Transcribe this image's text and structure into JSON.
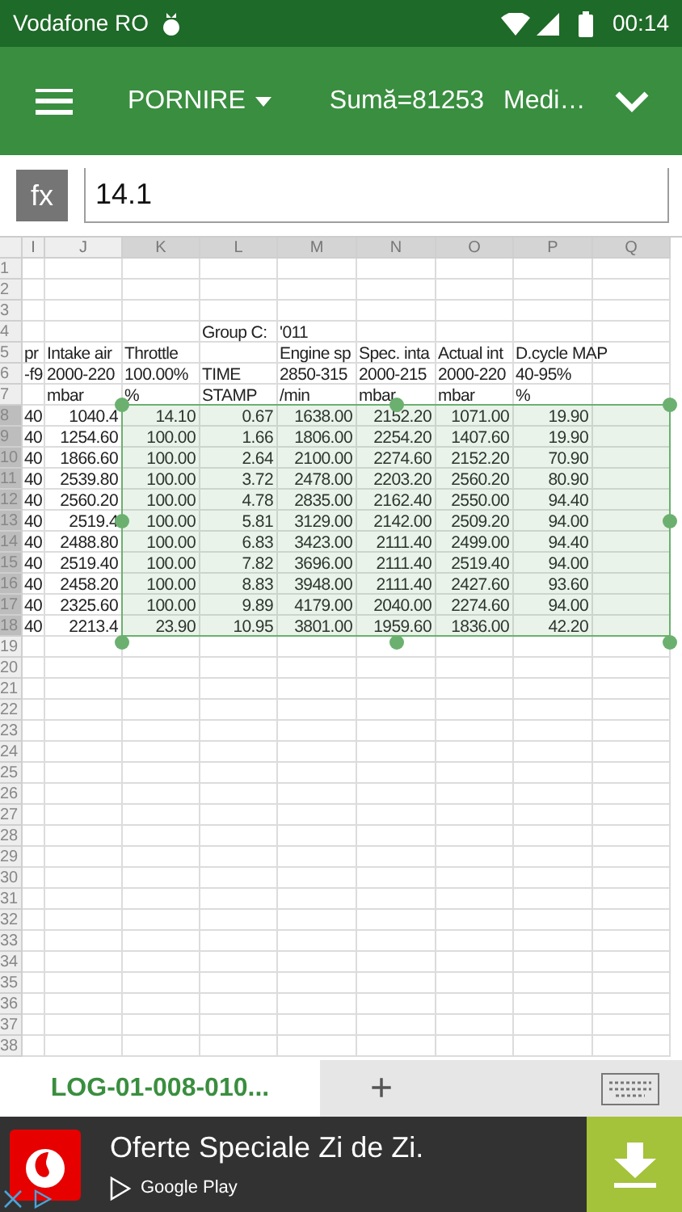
{
  "status_bar": {
    "carrier": "Vodafone RO",
    "time": "00:14"
  },
  "toolbar": {
    "menu": "PORNIRE",
    "sum": "Sumă=81253",
    "average": "Medi…"
  },
  "formula_bar": {
    "label": "fx",
    "value": "14.1"
  },
  "grid": {
    "columns": [
      {
        "label": "I",
        "selected": false
      },
      {
        "label": "J",
        "selected": false
      },
      {
        "label": "K",
        "selected": true
      },
      {
        "label": "L",
        "selected": true
      },
      {
        "label": "M",
        "selected": true
      },
      {
        "label": "N",
        "selected": true
      },
      {
        "label": "O",
        "selected": true
      },
      {
        "label": "P",
        "selected": true
      },
      {
        "label": "Q",
        "selected": true
      }
    ],
    "rows": [
      {
        "number": "1",
        "selected": false,
        "kind": "label",
        "cells": {}
      },
      {
        "number": "2",
        "selected": false,
        "kind": "label",
        "cells": {}
      },
      {
        "number": "3",
        "selected": false,
        "kind": "label",
        "cells": {}
      },
      {
        "number": "4",
        "selected": false,
        "kind": "label",
        "cells": {
          "L": "Group C:",
          "M": "'011"
        }
      },
      {
        "number": "5",
        "selected": false,
        "kind": "label",
        "cells": {
          "I": "pr",
          "J": "Intake air",
          "K": "Throttle",
          "M": "Engine sp",
          "N": "Spec. inta",
          "O": "Actual int",
          "P": "D.cycle MAP"
        }
      },
      {
        "number": "6",
        "selected": false,
        "kind": "label",
        "cells": {
          "I": "-f9",
          "J": "2000-220",
          "K": "100.00%",
          "L": "TIME",
          "M": "2850-315",
          "N": "2000-215",
          "O": "2000-220",
          "P": "40-95%"
        }
      },
      {
        "number": "7",
        "selected": false,
        "kind": "label",
        "cells": {
          "J": "mbar",
          "K": "%",
          "L": "STAMP",
          "M": "/min",
          "N": "mbar",
          "O": "mbar",
          "P": "%"
        }
      },
      {
        "number": "8",
        "selected": true,
        "kind": "data",
        "cells": {
          "I": "40",
          "J": "1040.4",
          "K": "14.10",
          "L": "0.67",
          "M": "1638.00",
          "N": "2152.20",
          "O": "1071.00",
          "P": "19.90"
        }
      },
      {
        "number": "9",
        "selected": true,
        "kind": "data",
        "cells": {
          "I": "40",
          "J": "1254.60",
          "K": "100.00",
          "L": "1.66",
          "M": "1806.00",
          "N": "2254.20",
          "O": "1407.60",
          "P": "19.90"
        }
      },
      {
        "number": "10",
        "selected": true,
        "kind": "data",
        "cells": {
          "I": "40",
          "J": "1866.60",
          "K": "100.00",
          "L": "2.64",
          "M": "2100.00",
          "N": "2274.60",
          "O": "2152.20",
          "P": "70.90"
        }
      },
      {
        "number": "11",
        "selected": true,
        "kind": "data",
        "cells": {
          "I": "40",
          "J": "2539.80",
          "K": "100.00",
          "L": "3.72",
          "M": "2478.00",
          "N": "2203.20",
          "O": "2560.20",
          "P": "80.90"
        }
      },
      {
        "number": "12",
        "selected": true,
        "kind": "data",
        "cells": {
          "I": "40",
          "J": "2560.20",
          "K": "100.00",
          "L": "4.78",
          "M": "2835.00",
          "N": "2162.40",
          "O": "2550.00",
          "P": "94.40"
        }
      },
      {
        "number": "13",
        "selected": true,
        "kind": "data",
        "cells": {
          "I": "40",
          "J": "2519.4",
          "K": "100.00",
          "L": "5.81",
          "M": "3129.00",
          "N": "2142.00",
          "O": "2509.20",
          "P": "94.00"
        }
      },
      {
        "number": "14",
        "selected": true,
        "kind": "data",
        "cells": {
          "I": "40",
          "J": "2488.80",
          "K": "100.00",
          "L": "6.83",
          "M": "3423.00",
          "N": "2111.40",
          "O": "2499.00",
          "P": "94.40"
        }
      },
      {
        "number": "15",
        "selected": true,
        "kind": "data",
        "cells": {
          "I": "40",
          "J": "2519.40",
          "K": "100.00",
          "L": "7.82",
          "M": "3696.00",
          "N": "2111.40",
          "O": "2519.40",
          "P": "94.00"
        }
      },
      {
        "number": "16",
        "selected": true,
        "kind": "data",
        "cells": {
          "I": "40",
          "J": "2458.20",
          "K": "100.00",
          "L": "8.83",
          "M": "3948.00",
          "N": "2111.40",
          "O": "2427.60",
          "P": "93.60"
        }
      },
      {
        "number": "17",
        "selected": true,
        "kind": "data",
        "cells": {
          "I": "40",
          "J": "2325.60",
          "K": "100.00",
          "L": "9.89",
          "M": "4179.00",
          "N": "2040.00",
          "O": "2274.60",
          "P": "94.00"
        }
      },
      {
        "number": "18",
        "selected": true,
        "kind": "data",
        "cells": {
          "I": "40",
          "J": "2213.4",
          "K": "23.90",
          "L": "10.95",
          "M": "3801.00",
          "N": "1959.60",
          "O": "1836.00",
          "P": "42.20"
        }
      },
      {
        "number": "19",
        "selected": false,
        "kind": "label",
        "cells": {}
      },
      {
        "number": "20",
        "selected": false,
        "kind": "label",
        "cells": {}
      },
      {
        "number": "21",
        "selected": false,
        "kind": "label",
        "cells": {}
      },
      {
        "number": "22",
        "selected": false,
        "kind": "label",
        "cells": {}
      },
      {
        "number": "23",
        "selected": false,
        "kind": "label",
        "cells": {}
      },
      {
        "number": "24",
        "selected": false,
        "kind": "label",
        "cells": {}
      },
      {
        "number": "25",
        "selected": false,
        "kind": "label",
        "cells": {}
      },
      {
        "number": "26",
        "selected": false,
        "kind": "label",
        "cells": {}
      },
      {
        "number": "27",
        "selected": false,
        "kind": "label",
        "cells": {}
      },
      {
        "number": "28",
        "selected": false,
        "kind": "label",
        "cells": {}
      },
      {
        "number": "29",
        "selected": false,
        "kind": "label",
        "cells": {}
      },
      {
        "number": "30",
        "selected": false,
        "kind": "label",
        "cells": {}
      },
      {
        "number": "31",
        "selected": false,
        "kind": "label",
        "cells": {}
      },
      {
        "number": "32",
        "selected": false,
        "kind": "label",
        "cells": {}
      },
      {
        "number": "33",
        "selected": false,
        "kind": "label",
        "cells": {}
      },
      {
        "number": "34",
        "selected": false,
        "kind": "label",
        "cells": {}
      },
      {
        "number": "35",
        "selected": false,
        "kind": "label",
        "cells": {}
      },
      {
        "number": "36",
        "selected": false,
        "kind": "label",
        "cells": {}
      },
      {
        "number": "37",
        "selected": false,
        "kind": "label",
        "cells": {}
      },
      {
        "number": "38",
        "selected": false,
        "kind": "label",
        "cells": {}
      }
    ]
  },
  "sheet_tabs": [
    {
      "label": "LOG-01-008-010...",
      "selected": true
    }
  ],
  "sheet_add": "+",
  "ad": {
    "title": "Oferte Speciale Zi de Zi.",
    "store": "Google Play"
  }
}
